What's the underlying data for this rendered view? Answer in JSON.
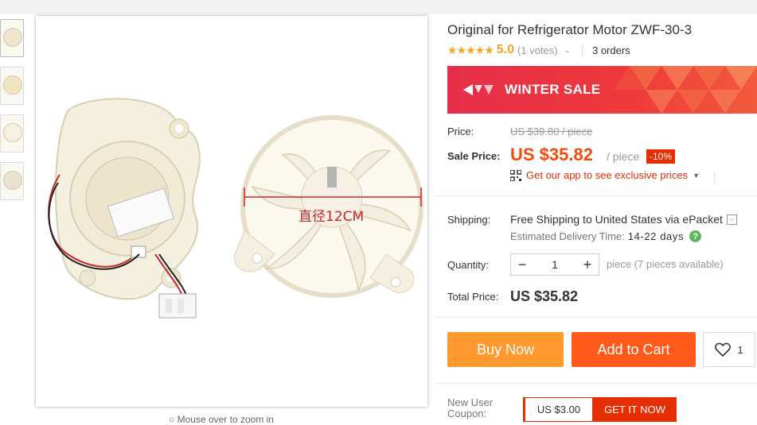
{
  "gallery": {
    "thumbnails": [
      "thumb-1",
      "thumb-2",
      "thumb-3",
      "thumb-4"
    ],
    "image_caption": "直径12CM",
    "zoom_hint": "Mouse over to zoom in"
  },
  "product": {
    "title": "Original for Refrigerator Motor ZWF-30-3",
    "rating": "5.0",
    "votes": "(1 votes)",
    "orders": "3 orders"
  },
  "banner": {
    "text": "WINTER SALE",
    "color": "#e62e4a"
  },
  "pricing": {
    "price_label": "Price:",
    "original_price": "US $39.80 / piece",
    "sale_label": "Sale Price:",
    "sale_price": "US $35.82",
    "unit": "/ piece",
    "discount": "-10%",
    "app_link": "Get our app to see exclusive prices",
    "accent_color": "#f44c08"
  },
  "shipping": {
    "label": "Shipping:",
    "prefix": "Free Shipping to ",
    "destination": "United States via ePacket",
    "estimate_label": "Estimated Delivery Time:",
    "estimate_days": "14-22 days"
  },
  "quantity": {
    "label": "Quantity:",
    "value": "1",
    "minus": "−",
    "plus": "+",
    "available": "piece (7 pieces available)"
  },
  "total": {
    "label": "Total Price:",
    "value": "US $35.82"
  },
  "actions": {
    "buy_now": "Buy Now",
    "add_to_cart": "Add to Cart",
    "wishlist_count": "1"
  },
  "coupon": {
    "label_line1": "New User",
    "label_line2": "Coupon:",
    "amount": "US $3.00",
    "cta": "GET IT NOW"
  }
}
